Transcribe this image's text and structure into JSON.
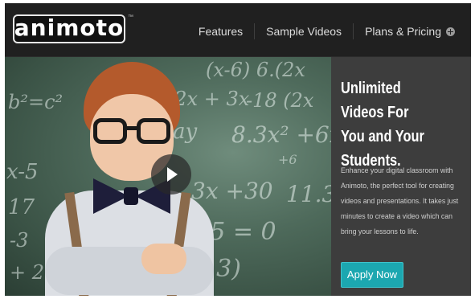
{
  "header": {
    "logo_text": "animoto",
    "logo_tm": "™",
    "nav": [
      {
        "label": "Features"
      },
      {
        "label": "Sample Videos"
      },
      {
        "label": "Plans & Pricing",
        "icon": "plus-circle-icon"
      }
    ]
  },
  "hero": {
    "chalkboard": [
      "b²=c²",
      "12x + 3x",
      "(x-6) 6.(2x",
      "-18 (2x",
      "x-ay",
      "8.3x² +6x",
      "+6",
      "3x +30",
      "11.3",
      "-15 = 0",
      "+3)",
      "x-5",
      "17",
      "-3",
      "+ 2"
    ],
    "play_icon": "play-icon"
  },
  "panel": {
    "title": "Unlimited Videos For\nYou and Your\nStudents.",
    "body": "Enhance your digital classroom with Animoto, the perfect tool for creating videos and presentations. It takes just minutes to create a video which can bring your lessons to life.",
    "cta_label": "Apply Now"
  },
  "colors": {
    "accent": "#1ca7b0",
    "header_bg": "#202020",
    "panel_bg": "#3d3d3d"
  }
}
